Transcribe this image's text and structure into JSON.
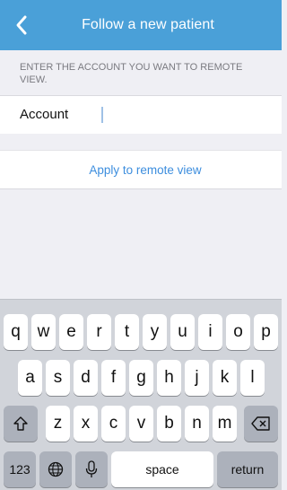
{
  "nav": {
    "title": "Follow a new patient",
    "back_icon": "chevron-left-icon"
  },
  "section": {
    "header": "ENTER THE ACCOUNT YOU WANT TO REMOTE VIEW."
  },
  "account": {
    "label": "Account",
    "value": ""
  },
  "apply": {
    "label": "Apply to remote view"
  },
  "keyboard": {
    "row1": [
      "q",
      "w",
      "e",
      "r",
      "t",
      "y",
      "u",
      "i",
      "o",
      "p"
    ],
    "row2": [
      "a",
      "s",
      "d",
      "f",
      "g",
      "h",
      "j",
      "k",
      "l"
    ],
    "row3": [
      "z",
      "x",
      "c",
      "v",
      "b",
      "n",
      "m"
    ],
    "numbers_label": "123",
    "space_label": "space",
    "return_label": "return"
  },
  "colors": {
    "nav_bg": "#4aa0d8",
    "link": "#3d8ede",
    "keyboard_bg": "#d1d4da"
  }
}
